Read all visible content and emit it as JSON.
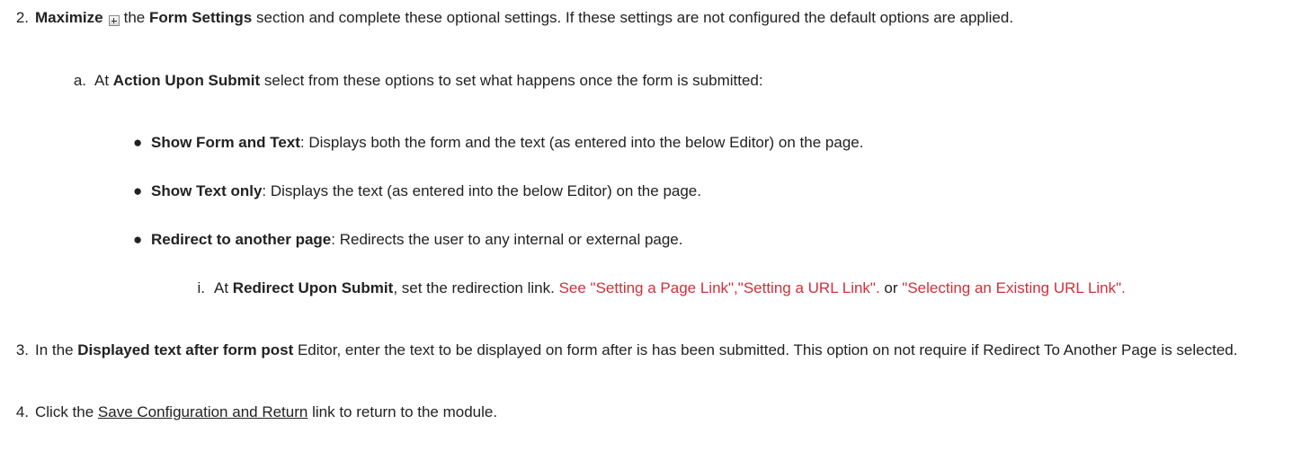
{
  "step2": {
    "number": "2.",
    "maximize": "Maximize",
    "text1": "the",
    "form_settings": "Form Settings",
    "text2": "section and complete these optional settings. If these settings are not configured the default options are applied."
  },
  "step2a": {
    "letter": "a.",
    "at": "At",
    "action_upon_submit": "Action Upon Submit",
    "text": "select from these options to set what happens once the form is submitted:",
    "options": [
      {
        "title": "Show Form and Text",
        "description": ": Displays both the form and the text (as entered into the below Editor) on the page."
      },
      {
        "title": "Show Text only",
        "description": ": Displays the text (as entered into the below Editor) on the page."
      },
      {
        "title": "Redirect to another page",
        "description": ": Redirects the user to any internal or external page."
      }
    ]
  },
  "step2ai": {
    "numeral": "i.",
    "at": "At",
    "redirect_upon_submit": "Redirect Upon Submit",
    "text": ", set the redirection link.",
    "link1": "See \"Setting a Page Link\",\"Setting a URL Link\".",
    "or": "or",
    "link2": "\"Selecting an Existing URL Link\"."
  },
  "step3": {
    "number": "3.",
    "in": "In the",
    "displayed_text": "Displayed text after form post",
    "text": "Editor, enter the text to be displayed on form after is has been submitted. This option on not require if Redirect To Another Page is selected."
  },
  "step4": {
    "number": "4.",
    "click": "Click the",
    "link": "Save Configuration and Return",
    "text": "link to return to the module."
  },
  "colors": {
    "text": "#222222",
    "link": "#d0303c"
  },
  "icons": {
    "maximize": "plus-box-icon",
    "bullet": "bullet-dot-icon"
  }
}
